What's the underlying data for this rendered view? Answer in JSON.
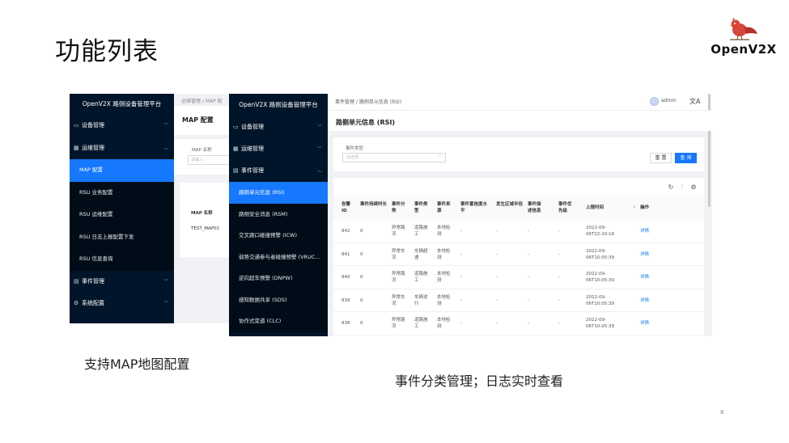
{
  "slide": {
    "title": "功能列表",
    "logo_text": "OpenV2X",
    "caption_left": "支持MAP地图配置",
    "caption_right": "事件分类管理；日志实时查看",
    "page_number": "8"
  },
  "colors": {
    "sidebar_bg": "#001529",
    "accent": "#1677ff"
  },
  "shot1": {
    "sidebar_title": "OpenV2X 路侧设备管理平台",
    "menu": [
      {
        "icon": "device-icon",
        "label": "设备管理",
        "chevron": "﹀"
      },
      {
        "icon": "ops-icon",
        "label": "运维管理",
        "chevron": "︿"
      },
      {
        "label": "MAP 配置"
      },
      {
        "label": "RSU 业务配置"
      },
      {
        "label": "RSU 运维配置"
      },
      {
        "label": "RSU 日志上报配置下发"
      },
      {
        "label": "RSU 信息查询"
      },
      {
        "icon": "event-icon",
        "label": "事件管理",
        "chevron": "﹀"
      },
      {
        "icon": "settings-icon",
        "label": "系统配置",
        "chevron": "﹀"
      }
    ],
    "breadcrumb": "运维管理 / MAP 配",
    "page_title": "MAP 配置",
    "filter_label": "MAP 名称",
    "filter_placeholder": "请输入",
    "table_header": "MAP 名称",
    "table_value": "TEST_MAP01"
  },
  "shot2": {
    "sidebar_title": "OpenV2X 路侧设备管理平台",
    "menu": [
      {
        "icon": "device-icon",
        "label": "设备管理",
        "chevron": "﹀"
      },
      {
        "icon": "ops-icon",
        "label": "运维管理",
        "chevron": "﹀"
      },
      {
        "icon": "event-icon",
        "label": "事件管理",
        "chevron": "︿"
      },
      {
        "label": "路侧单元信息 (RSI)"
      },
      {
        "label": "路侧安全消息 (RSM)"
      },
      {
        "label": "交叉路口碰撞预警 (ICW)"
      },
      {
        "label": "弱势交通参与者碰撞预警 (VRUC..."
      },
      {
        "label": "逆向超车预警 (DNPW)"
      },
      {
        "label": "感知数据共享 (SDS)"
      },
      {
        "label": "协作式变道 (CLC)"
      }
    ],
    "breadcrumb": "事件管理 / 路侧单元信息 (RSI)",
    "username": "admin",
    "lang_icon": "文A",
    "page_title": "路侧单元信息 (RSI)",
    "filter_label": "事件类型",
    "filter_placeholder": "请选择",
    "reset_label": "重 置",
    "query_label": "查 询",
    "columns": [
      "告警 ID",
      "事件持续时长",
      "事件分类",
      "事件类型",
      "事件来源",
      "事件置信度水平",
      "发生区域半径",
      "事件描述信息",
      "事件优先级",
      "上报时间",
      "操作"
    ],
    "rows": [
      {
        "id": "842",
        "duration": "0",
        "category": "异常路况",
        "type": "道路施工",
        "source": "本地检测",
        "confidence": "-",
        "radius": "-",
        "desc": "-",
        "priority": "-",
        "time": "2022-09-06T22:10:16",
        "action": "详情"
      },
      {
        "id": "841",
        "duration": "0",
        "category": "异常车况",
        "type": "车辆超速",
        "source": "本地检测",
        "confidence": "-",
        "radius": "-",
        "desc": "-",
        "priority": "-",
        "time": "2022-09-06T10:05:39",
        "action": "详情"
      },
      {
        "id": "840",
        "duration": "0",
        "category": "异常路况",
        "type": "道路施工",
        "source": "本地检测",
        "confidence": "-",
        "radius": "-",
        "desc": "-",
        "priority": "-",
        "time": "2022-09-06T10:05:39",
        "action": "详情"
      },
      {
        "id": "839",
        "duration": "0",
        "category": "异常车况",
        "type": "车辆逆行",
        "source": "本地检测",
        "confidence": "-",
        "radius": "-",
        "desc": "-",
        "priority": "-",
        "time": "2022-09-06T10:05:39",
        "action": "详情"
      },
      {
        "id": "838",
        "duration": "0",
        "category": "异常路况",
        "type": "道路施工",
        "source": "本地检测",
        "confidence": "-",
        "radius": "-",
        "desc": "-",
        "priority": "-",
        "time": "2022-09-06T10:05:39",
        "action": "详情"
      }
    ]
  }
}
